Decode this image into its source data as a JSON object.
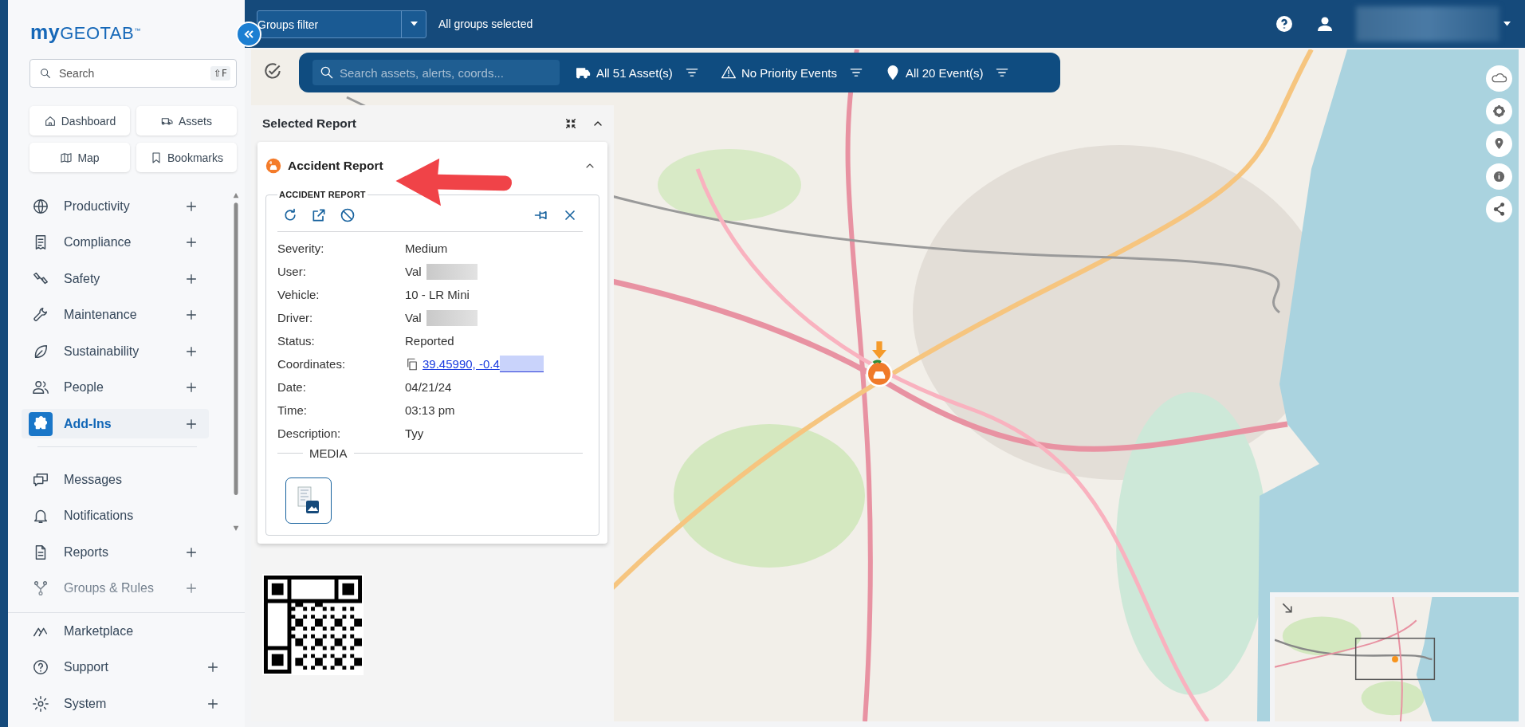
{
  "sidebar": {
    "logo": {
      "prefix": "my",
      "name": "GEOTAB",
      "mark": "™"
    },
    "search": {
      "placeholder": "Search",
      "shortcut": "⇧F"
    },
    "quick_links": [
      {
        "label": "Dashboard"
      },
      {
        "label": "Assets"
      },
      {
        "label": "Map"
      },
      {
        "label": "Bookmarks"
      }
    ],
    "nav_items": [
      {
        "label": "Productivity",
        "expandable": true,
        "selected": false
      },
      {
        "label": "Compliance",
        "expandable": true,
        "selected": false
      },
      {
        "label": "Safety",
        "expandable": true,
        "selected": false
      },
      {
        "label": "Maintenance",
        "expandable": true,
        "selected": false
      },
      {
        "label": "Sustainability",
        "expandable": true,
        "selected": false
      },
      {
        "label": "People",
        "expandable": true,
        "selected": false
      },
      {
        "label": "Add-Ins",
        "expandable": true,
        "selected": true
      }
    ],
    "secondary_items": [
      {
        "label": "Messages",
        "expandable": false,
        "selected": false
      },
      {
        "label": "Notifications",
        "expandable": false,
        "selected": false
      },
      {
        "label": "Reports",
        "expandable": true,
        "selected": false
      },
      {
        "label": "Groups & Rules",
        "expandable": true,
        "selected": false
      }
    ],
    "footer_items": [
      {
        "label": "Marketplace",
        "expandable": false,
        "selected": false
      },
      {
        "label": "Support",
        "expandable": true,
        "selected": false
      },
      {
        "label": "System",
        "expandable": true,
        "selected": false
      }
    ]
  },
  "top_bar": {
    "groups_filter": "Groups filter",
    "groups_status": "All groups selected"
  },
  "filter_bar": {
    "search_placeholder": "Search assets, alerts, coords...",
    "filters": [
      {
        "label": "All 51 Asset(s)"
      },
      {
        "label": "No Priority Events"
      },
      {
        "label": "All 20 Event(s)"
      }
    ]
  },
  "report_panel": {
    "title": "Selected Report",
    "card": {
      "title": "Accident Report",
      "section_label": "ACCIDENT REPORT",
      "fields": [
        {
          "label": "Severity:",
          "value": "Medium",
          "kind": "text",
          "redacted": false
        },
        {
          "label": "User:",
          "value": "Val",
          "kind": "text",
          "redacted": true
        },
        {
          "label": "Vehicle:",
          "value": "10 - LR Mini",
          "kind": "text",
          "redacted": false
        },
        {
          "label": "Driver:",
          "value": "Val",
          "kind": "text",
          "redacted": true
        },
        {
          "label": "Status:",
          "value": "Reported",
          "kind": "text",
          "redacted": false
        },
        {
          "label": "Coordinates:",
          "value": "39.45990, -0.4",
          "kind": "link",
          "redacted": true
        },
        {
          "label": "Date:",
          "value": "04/21/24",
          "kind": "text",
          "redacted": false
        },
        {
          "label": "Time:",
          "value": "03:13 pm",
          "kind": "text",
          "redacted": false
        },
        {
          "label": "Description:",
          "value": "Tyy",
          "kind": "text",
          "redacted": false
        }
      ],
      "media_label": "MEDIA"
    }
  }
}
